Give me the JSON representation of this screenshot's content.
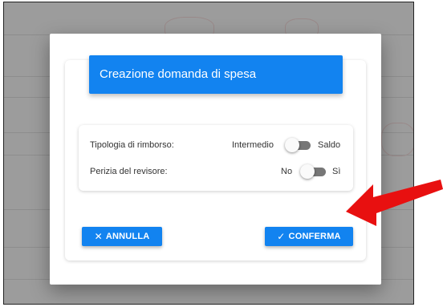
{
  "dialog": {
    "title": "Creazione domanda di spesa",
    "options": [
      {
        "label": "Tipologia di rimborso:",
        "left_value": "Intermedio",
        "right_value": "Saldo",
        "toggled_right": false
      },
      {
        "label": "Perizia del revisore:",
        "left_value": "No",
        "right_value": "Sì",
        "toggled_right": false
      }
    ],
    "cancel_label": "ANNULLA",
    "cancel_icon": "close-icon",
    "confirm_label": "CONFERMA",
    "confirm_icon": "check-icon"
  },
  "colors": {
    "accent": "#1283f0",
    "annotation_arrow": "#e81010"
  }
}
